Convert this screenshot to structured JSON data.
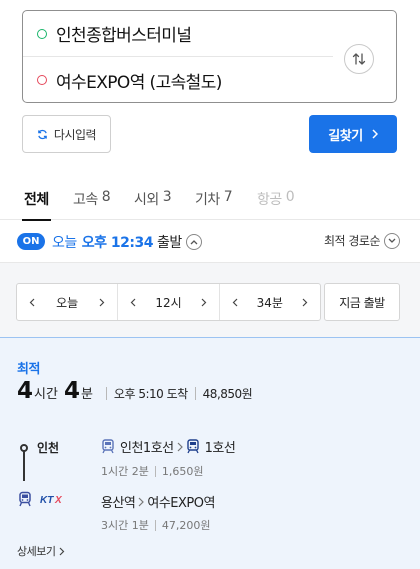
{
  "route": {
    "origin": "인천종합버스터미널",
    "destination": "여수EXPO역 (고속철도)",
    "swap_icon": "swap-icon"
  },
  "actions": {
    "reset_label": "다시입력",
    "search_label": "길찾기"
  },
  "tabs": [
    {
      "label": "전체",
      "count": "",
      "state": "active"
    },
    {
      "label": "고속",
      "count": "8",
      "state": "normal"
    },
    {
      "label": "시외",
      "count": "3",
      "state": "normal"
    },
    {
      "label": "기차",
      "count": "7",
      "state": "normal"
    },
    {
      "label": "항공",
      "count": "0",
      "state": "disabled"
    }
  ],
  "time": {
    "badge": "ON",
    "day": "오늘",
    "clock": "오후 12:34",
    "suffix": "출발",
    "sort_label": "최적 경로순"
  },
  "selector": {
    "day": "오늘",
    "hour": "12시",
    "minute": "34분",
    "now_label": "지금 출발"
  },
  "result": {
    "label": "최적",
    "hours": "4",
    "hours_unit": "시간",
    "minutes": "4",
    "minutes_unit": "분",
    "arrival": "오후 5:10 도착",
    "fare": "48,850원",
    "start_stop": "인천",
    "leg1_from": "인천1호선",
    "leg1_to": "1호선",
    "leg1_duration": "1시간 2분",
    "leg1_fare": "1,650원",
    "leg2_from": "용산역",
    "leg2_to": "여수EXPO역",
    "leg2_duration": "3시간 1분",
    "leg2_fare": "47,200원",
    "ktx_logo": "KTX",
    "detail_label": "상세보기"
  },
  "colors": {
    "accent": "#1a73e8",
    "origin_dot": "#19b56a",
    "destination_dot": "#e5485b",
    "result_bg": "#eef4fc"
  }
}
